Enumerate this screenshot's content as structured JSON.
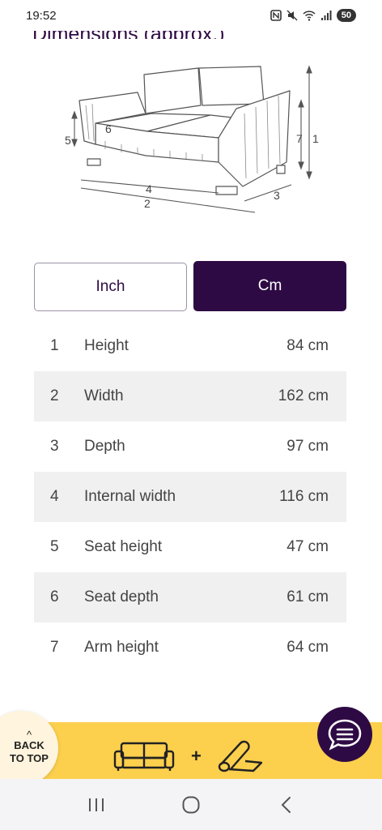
{
  "status_bar": {
    "time": "19:52",
    "battery": "50"
  },
  "heading": "Dimensions (approx.)",
  "diagram_labels": [
    "1",
    "2",
    "3",
    "4",
    "5",
    "6",
    "7"
  ],
  "unit_toggle": {
    "inch_label": "Inch",
    "cm_label": "Cm",
    "selected": "Cm"
  },
  "dimensions": [
    {
      "num": "1",
      "label": "Height",
      "value": "84 cm"
    },
    {
      "num": "2",
      "label": "Width",
      "value": "162 cm"
    },
    {
      "num": "3",
      "label": "Depth",
      "value": "97 cm"
    },
    {
      "num": "4",
      "label": "Internal width",
      "value": "116 cm"
    },
    {
      "num": "5",
      "label": "Seat height",
      "value": "47 cm"
    },
    {
      "num": "6",
      "label": "Seat depth",
      "value": "61 cm"
    },
    {
      "num": "7",
      "label": "Arm height",
      "value": "64 cm"
    }
  ],
  "back_to_top": {
    "line1": "BACK",
    "line2": "TO TOP"
  },
  "promo": {
    "plus": "+",
    "icons": [
      "sofa-icon",
      "carpet-roll-icon"
    ]
  },
  "colors": {
    "brand_purple": "#2e0a44",
    "banner_yellow": "#fccf4d",
    "row_alt": "#f0f0f1"
  },
  "nav": {
    "icons": [
      "recent-apps-icon",
      "home-icon",
      "back-icon"
    ]
  }
}
